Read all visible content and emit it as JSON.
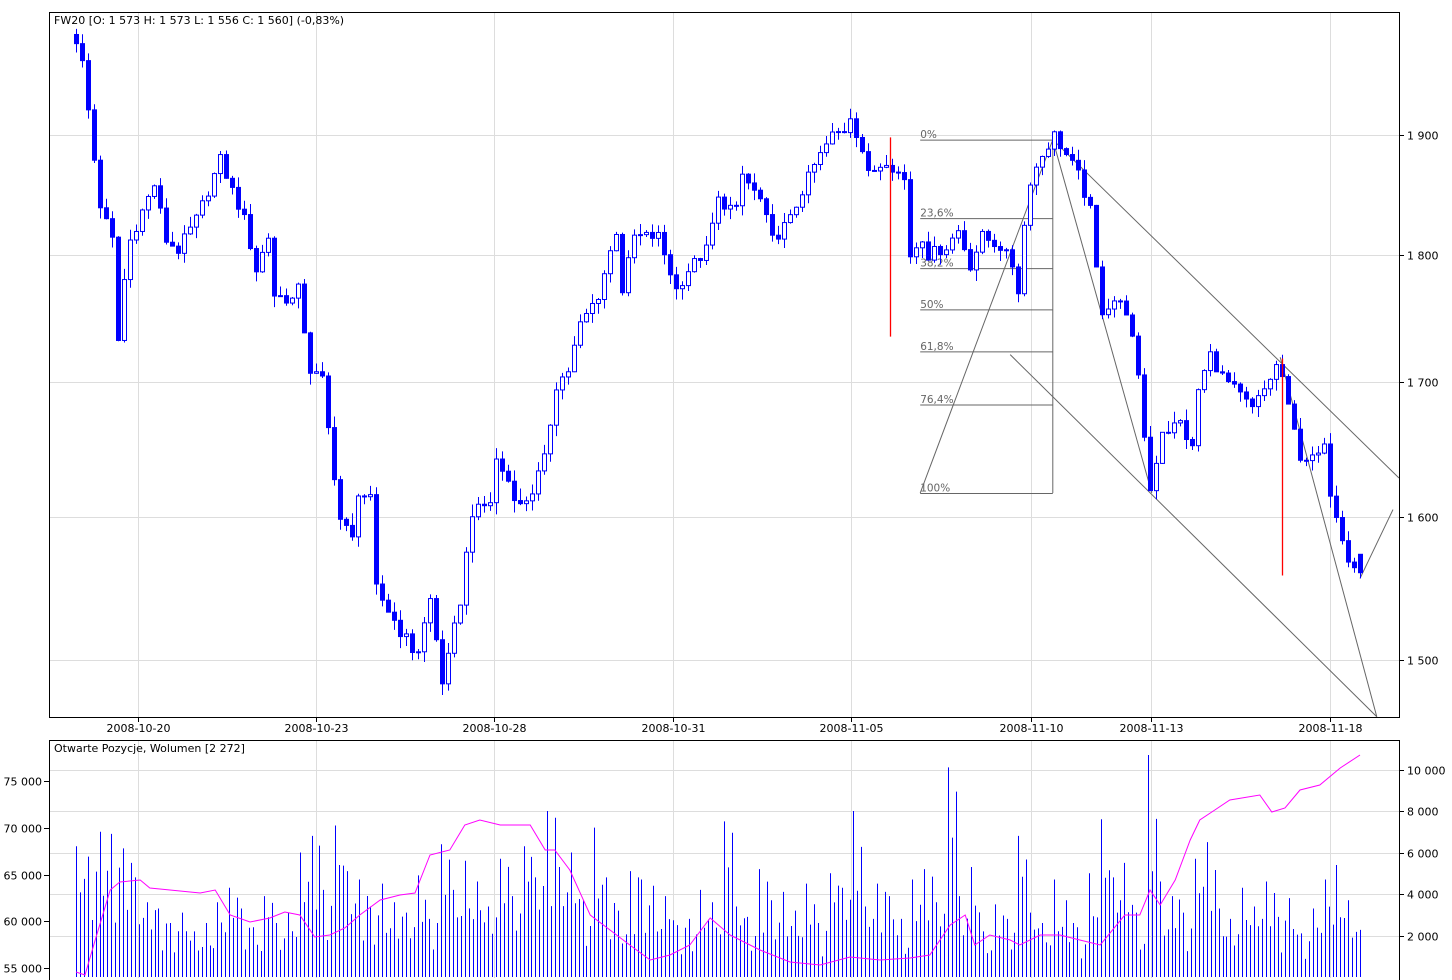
{
  "colors": {
    "candle": "#0000ff",
    "grid": "#dddddd",
    "frame": "#000000",
    "drawing": "#666666",
    "marker": "#ff0000",
    "open_interest": "#ff00ff",
    "volume": "#0000ff"
  },
  "chart_data": [
    {
      "type": "candlestick",
      "title": "FW20 [O: 1 573  H: 1 573  L: 1 556  C: 1 560] (-0,83%)",
      "scale": "log",
      "y_ticks": [
        {
          "value": 1900,
          "label": "1 900"
        },
        {
          "value": 1800,
          "label": "1 800"
        },
        {
          "value": 1700,
          "label": "1 700"
        },
        {
          "value": 1600,
          "label": "1 600"
        },
        {
          "value": 1500,
          "label": "1 500"
        }
      ],
      "x_ticks": [
        {
          "index": 10.3,
          "label": "2008-10-20"
        },
        {
          "index": 40,
          "label": "2008-10-23"
        },
        {
          "index": 69.7,
          "label": "2008-10-28"
        },
        {
          "index": 99.5,
          "label": "2008-10-31"
        },
        {
          "index": 129.2,
          "label": "2008-11-05"
        },
        {
          "index": 159.2,
          "label": "2008-11-10"
        },
        {
          "index": 179.2,
          "label": "2008-11-13"
        },
        {
          "index": 209,
          "label": "2008-11-18"
        }
      ],
      "candle_count": 215,
      "close_waypoints": [
        [
          0,
          1983
        ],
        [
          1.5,
          1952
        ],
        [
          2,
          1921
        ],
        [
          3,
          1879
        ],
        [
          4,
          1841
        ],
        [
          6,
          1812
        ],
        [
          7,
          1732
        ],
        [
          8,
          1780
        ],
        [
          9,
          1812
        ],
        [
          11,
          1836
        ],
        [
          13,
          1858
        ],
        [
          15,
          1812
        ],
        [
          17,
          1804
        ],
        [
          20,
          1829
        ],
        [
          22,
          1853
        ],
        [
          24,
          1879
        ],
        [
          26,
          1853
        ],
        [
          28,
          1829
        ],
        [
          30,
          1788
        ],
        [
          32,
          1815
        ],
        [
          33,
          1768
        ],
        [
          36,
          1764
        ],
        [
          37,
          1772
        ],
        [
          39,
          1709
        ],
        [
          41,
          1701
        ],
        [
          42,
          1664
        ],
        [
          44,
          1598
        ],
        [
          46,
          1583
        ],
        [
          47,
          1619
        ],
        [
          49,
          1611
        ],
        [
          50,
          1548
        ],
        [
          52,
          1534
        ],
        [
          54,
          1520
        ],
        [
          56,
          1507
        ],
        [
          57,
          1507
        ],
        [
          59,
          1541
        ],
        [
          61,
          1486
        ],
        [
          62,
          1500
        ],
        [
          64,
          1541
        ],
        [
          66,
          1604
        ],
        [
          67,
          1604
        ],
        [
          69,
          1611
        ],
        [
          70,
          1641
        ],
        [
          72,
          1626
        ],
        [
          74,
          1607
        ],
        [
          76,
          1619
        ],
        [
          78,
          1641
        ],
        [
          80,
          1698
        ],
        [
          82,
          1709
        ],
        [
          84,
          1744
        ],
        [
          87,
          1768
        ],
        [
          90,
          1820
        ],
        [
          91,
          1772
        ],
        [
          93,
          1815
        ],
        [
          97,
          1815
        ],
        [
          100,
          1772
        ],
        [
          102,
          1788
        ],
        [
          105,
          1804
        ],
        [
          107,
          1845
        ],
        [
          110,
          1836
        ],
        [
          111,
          1866
        ],
        [
          114,
          1845
        ],
        [
          116,
          1812
        ],
        [
          119,
          1829
        ],
        [
          121,
          1853
        ],
        [
          123,
          1874
        ],
        [
          126,
          1900
        ],
        [
          128,
          1904
        ],
        [
          129,
          1917
        ],
        [
          131,
          1887
        ],
        [
          132,
          1866
        ],
        [
          135,
          1879
        ],
        [
          138,
          1862
        ],
        [
          139,
          1800
        ],
        [
          141,
          1815
        ],
        [
          142,
          1800
        ],
        [
          145,
          1807
        ],
        [
          147,
          1820
        ],
        [
          149,
          1792
        ],
        [
          151,
          1815
        ],
        [
          154,
          1807
        ],
        [
          156,
          1792
        ],
        [
          157,
          1772
        ],
        [
          158,
          1824
        ],
        [
          159,
          1862
        ],
        [
          161,
          1883
        ],
        [
          163,
          1900
        ],
        [
          165,
          1883
        ],
        [
          167,
          1866
        ],
        [
          169,
          1836
        ],
        [
          170,
          1788
        ],
        [
          171,
          1756
        ],
        [
          173,
          1764
        ],
        [
          175,
          1756
        ],
        [
          176,
          1732
        ],
        [
          177,
          1701
        ],
        [
          179,
          1619
        ],
        [
          181,
          1664
        ],
        [
          182,
          1664
        ],
        [
          184,
          1669
        ],
        [
          186,
          1649
        ],
        [
          187,
          1694
        ],
        [
          189,
          1721
        ],
        [
          191,
          1704
        ],
        [
          193,
          1694
        ],
        [
          196,
          1679
        ],
        [
          198,
          1694
        ],
        [
          200,
          1712
        ],
        [
          201,
          1704
        ],
        [
          202,
          1679
        ],
        [
          204,
          1645
        ],
        [
          206,
          1641
        ],
        [
          208,
          1649
        ],
        [
          209,
          1619
        ],
        [
          211,
          1587
        ],
        [
          212,
          1572
        ],
        [
          214,
          1560
        ]
      ],
      "last_candle": {
        "open": 1573,
        "high": 1573,
        "low": 1556,
        "close": 1560,
        "change": "-0,83%"
      },
      "fibonacci": {
        "high": 1896,
        "low": 1617,
        "start_index": 140.7,
        "end_index": 162.8,
        "levels": [
          {
            "ratio": 0,
            "label": "0%"
          },
          {
            "ratio": 0.236,
            "label": "23,6%"
          },
          {
            "ratio": 0.382,
            "label": "38,2%"
          },
          {
            "ratio": 0.5,
            "label": "50%"
          },
          {
            "ratio": 0.618,
            "label": "61,8%"
          },
          {
            "ratio": 0.764,
            "label": "76,4%"
          },
          {
            "ratio": 1,
            "label": "100%"
          }
        ]
      },
      "trendlines": [
        [
          [
            140.7,
            1617
          ],
          [
            162.8,
            1896
          ]
        ],
        [
          [
            162.8,
            1896
          ],
          [
            179.3,
            1617
          ]
        ],
        [
          [
            162.8,
            1896
          ],
          [
            220.5,
            1628
          ]
        ],
        [
          [
            155.7,
            1721
          ],
          [
            216.8,
            1462
          ]
        ],
        [
          [
            200.7,
            1719
          ],
          [
            216.8,
            1462
          ]
        ],
        [
          [
            214,
            1556
          ],
          [
            219.5,
            1605
          ]
        ]
      ],
      "markers": [
        {
          "index": 135.7,
          "from": 1898,
          "to": 1735
        },
        {
          "index": 201,
          "from": 1718,
          "to": 1558
        }
      ]
    },
    {
      "type": "bar+line",
      "title": "Otwarte Pozycje, Wolumen [2 272]",
      "left_axis": {
        "name": "Otwarte Pozycje",
        "ticks": [
          {
            "value": 75000,
            "label": "75 000"
          },
          {
            "value": 70000,
            "label": "70 000"
          },
          {
            "value": 65000,
            "label": "65 000"
          },
          {
            "value": 60000,
            "label": "60 000"
          },
          {
            "value": 55000,
            "label": "55 000"
          }
        ]
      },
      "right_axis": {
        "name": "Wolumen",
        "ticks": [
          {
            "value": 10000,
            "label": "10 000"
          },
          {
            "value": 8000,
            "label": "8 000"
          },
          {
            "value": 6000,
            "label": "6 000"
          },
          {
            "value": 4000,
            "label": "4 000"
          },
          {
            "value": 2000,
            "label": "2 000"
          }
        ]
      },
      "volume": [
        6300,
        5800,
        7000,
        6900,
        6200,
        4800,
        3600,
        3300,
        2600,
        3100,
        2200,
        2600,
        3600,
        4300,
        3300,
        2400,
        3900,
        2600,
        3100,
        6000,
        6800,
        4200,
        7300,
        5100,
        4700,
        3400,
        4500,
        3600,
        3100,
        4900,
        2800,
        6400,
        4200,
        5600,
        4600,
        3400,
        5700,
        3900,
        6300,
        4800,
        8000,
        5300,
        6000,
        3700,
        7200,
        4800,
        3200,
        5100,
        4700,
        4400,
        3900,
        2500,
        2800,
        4200,
        3600,
        7500,
        3400,
        2900,
        5200,
        3700,
        4100,
        3200,
        4500,
        2600,
        5000,
        4300,
        8000,
        3400,
        4500,
        3900,
        2800,
        4700,
        5200,
        3600,
        10100,
        3900,
        5300,
        2200,
        3500,
        2800,
        6800,
        3100,
        2600,
        4700,
        3700,
        2400,
        5000,
        7600,
        4800,
        5500,
        3100,
        10700,
        4600,
        3900,
        3100,
        5700,
        6500,
        3300,
        2800,
        4300,
        3400,
        4600,
        2900,
        3800,
        2100,
        3300,
        4700,
        5400,
        3700,
        2272
      ],
      "open_interest": [
        [
          0,
          54570
        ],
        [
          1.5,
          54250
        ],
        [
          3.2,
          58000
        ],
        [
          5.7,
          63340
        ],
        [
          7.3,
          64200
        ],
        [
          10.7,
          64410
        ],
        [
          12.3,
          63560
        ],
        [
          20.7,
          63020
        ],
        [
          23.2,
          63340
        ],
        [
          25.7,
          60670
        ],
        [
          29,
          59920
        ],
        [
          32.3,
          60350
        ],
        [
          34.8,
          60990
        ],
        [
          37.3,
          60670
        ],
        [
          39.8,
          58320
        ],
        [
          42.3,
          58530
        ],
        [
          44.8,
          59280
        ],
        [
          47.3,
          60670
        ],
        [
          50.7,
          62270
        ],
        [
          54,
          62810
        ],
        [
          56.5,
          63020
        ],
        [
          59,
          67090
        ],
        [
          62.3,
          67620
        ],
        [
          64.8,
          70290
        ],
        [
          67.3,
          70830
        ],
        [
          70.7,
          70290
        ],
        [
          75.7,
          70290
        ],
        [
          78.2,
          67620
        ],
        [
          79.8,
          67620
        ],
        [
          82.3,
          65480
        ],
        [
          85.7,
          60670
        ],
        [
          89,
          59060
        ],
        [
          92.3,
          57460
        ],
        [
          95.7,
          55860
        ],
        [
          99,
          56390
        ],
        [
          102.3,
          57460
        ],
        [
          105.7,
          60350
        ],
        [
          109,
          58530
        ],
        [
          114,
          56930
        ],
        [
          119,
          55640
        ],
        [
          124,
          55320
        ],
        [
          129,
          56180
        ],
        [
          134,
          55860
        ],
        [
          139,
          56070
        ],
        [
          142.3,
          56390
        ],
        [
          145.7,
          59600
        ],
        [
          148.2,
          60670
        ],
        [
          149.8,
          57460
        ],
        [
          152.3,
          58530
        ],
        [
          155.7,
          58000
        ],
        [
          157.3,
          57460
        ],
        [
          160.7,
          58530
        ],
        [
          164,
          58530
        ],
        [
          167.3,
          58000
        ],
        [
          170.7,
          57460
        ],
        [
          174.8,
          60670
        ],
        [
          177.3,
          60670
        ],
        [
          179,
          63340
        ],
        [
          180.7,
          61740
        ],
        [
          183.2,
          64410
        ],
        [
          185.7,
          68690
        ],
        [
          187.3,
          70830
        ],
        [
          189.8,
          71900
        ],
        [
          192.3,
          72970
        ],
        [
          197.3,
          73500
        ],
        [
          199.3,
          71680
        ],
        [
          201.5,
          72110
        ],
        [
          204,
          74040
        ],
        [
          207.3,
          74570
        ],
        [
          210.7,
          76390
        ],
        [
          214,
          77780
        ]
      ]
    }
  ]
}
